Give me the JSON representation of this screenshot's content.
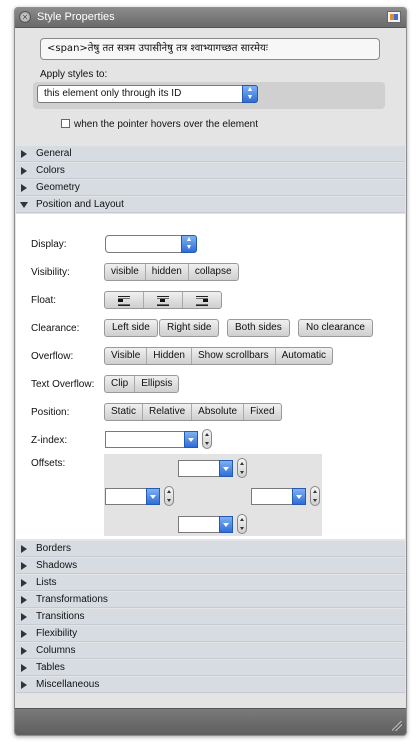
{
  "window": {
    "title": "Style Properties"
  },
  "element": {
    "tag_text": "<span>तेषु तत सत्रम उपासीनेषु तत्र श्वाभ्यागच्छत सारमेयः"
  },
  "apply": {
    "label": "Apply styles to:",
    "selected": "this element only through its ID",
    "hover_checkbox": {
      "label": "when the pointer hovers over the element",
      "checked": false
    }
  },
  "sections_top": [
    {
      "label": "General",
      "expanded": false
    },
    {
      "label": "Colors",
      "expanded": false
    },
    {
      "label": "Geometry",
      "expanded": false
    },
    {
      "label": "Position and Layout",
      "expanded": true
    }
  ],
  "position_layout": {
    "display": {
      "label": "Display:",
      "value": ""
    },
    "visibility": {
      "label": "Visibility:",
      "options": [
        "visible",
        "hidden",
        "collapse"
      ]
    },
    "float": {
      "label": "Float:",
      "options": [
        "float-left-icon",
        "float-none-icon",
        "float-right-icon"
      ]
    },
    "clearance": {
      "label": "Clearance:",
      "options": [
        "Left side",
        "Right side",
        "Both sides",
        "No clearance"
      ]
    },
    "overflow": {
      "label": "Overflow:",
      "options": [
        "Visible",
        "Hidden",
        "Show scrollbars",
        "Automatic"
      ]
    },
    "text_overflow": {
      "label": "Text Overflow:",
      "options": [
        "Clip",
        "Ellipsis"
      ]
    },
    "position": {
      "label": "Position:",
      "options": [
        "Static",
        "Relative",
        "Absolute",
        "Fixed"
      ]
    },
    "zindex": {
      "label": "Z-index:",
      "value": ""
    },
    "offsets": {
      "label": "Offsets:",
      "top": "",
      "left": "",
      "right": "",
      "bottom": ""
    }
  },
  "sections_bottom": [
    {
      "label": "Borders"
    },
    {
      "label": "Shadows"
    },
    {
      "label": "Lists"
    },
    {
      "label": "Transformations"
    },
    {
      "label": "Transitions"
    },
    {
      "label": "Flexibility"
    },
    {
      "label": "Columns"
    },
    {
      "label": "Tables"
    },
    {
      "label": "Miscellaneous"
    }
  ],
  "colors": {
    "accent": "#2f6ed6",
    "section_bg": "#d7dce3",
    "titlebar": "#6f6f6f"
  }
}
